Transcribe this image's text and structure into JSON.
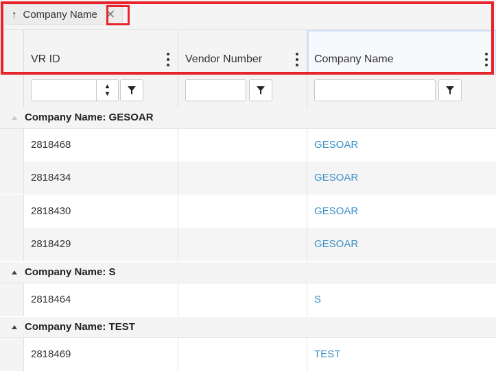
{
  "group_panel": {
    "chip_label": "Company Name",
    "chip_sort_icon": "up-arrow-icon",
    "chip_remove_icon": "close-icon"
  },
  "columns": [
    {
      "label": "VR ID"
    },
    {
      "label": "Vendor Number"
    },
    {
      "label": "Company Name"
    }
  ],
  "filters": {
    "vr_id_value": "",
    "vendor_number_value": "",
    "company_name_value": ""
  },
  "groups": [
    {
      "label": "Company Name: GESOAR",
      "rows": [
        {
          "vr_id": "2818468",
          "vendor_number": "",
          "company_name": "GESOAR"
        },
        {
          "vr_id": "2818434",
          "vendor_number": "",
          "company_name": "GESOAR"
        },
        {
          "vr_id": "2818430",
          "vendor_number": "",
          "company_name": "GESOAR"
        },
        {
          "vr_id": "2818429",
          "vendor_number": "",
          "company_name": "GESOAR"
        }
      ]
    },
    {
      "label": "Company Name: S",
      "rows": [
        {
          "vr_id": "2818464",
          "vendor_number": "",
          "company_name": "S"
        }
      ]
    },
    {
      "label": "Company Name: TEST",
      "rows": [
        {
          "vr_id": "2818469",
          "vendor_number": "",
          "company_name": "TEST"
        }
      ]
    }
  ],
  "colors": {
    "highlight": "#e8232b",
    "link": "#3d8fc6"
  }
}
